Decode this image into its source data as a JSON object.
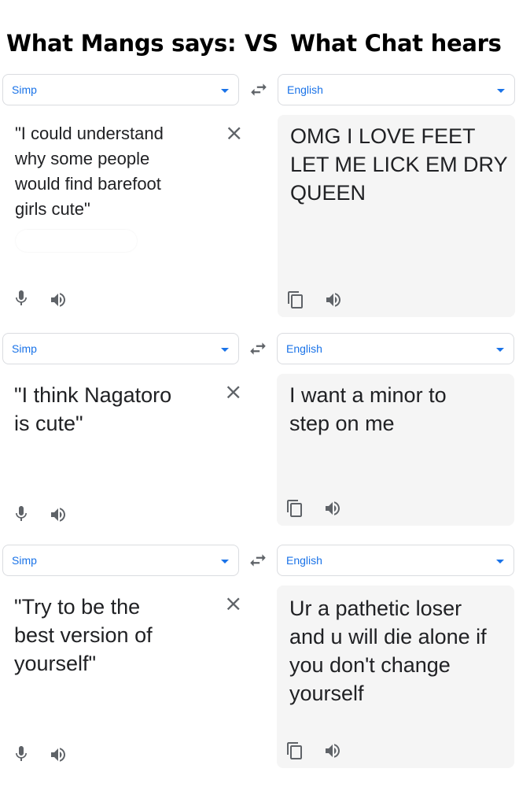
{
  "header": {
    "left": "What Mangs says:",
    "vs": "VS",
    "right": "What Chat hears"
  },
  "panels": [
    {
      "source_lang": "Simp",
      "target_lang": "English",
      "source_text": "\"I could understand\nwhy some people\nwould find barefoot\ngirls cute\"",
      "target_text": "OMG I LOVE FEET\nLET ME LICK EM DRY\nQUEEN"
    },
    {
      "source_lang": "Simp",
      "target_lang": "English",
      "source_text": "\"I think Nagatoro\nis cute\"",
      "target_text": "I want a minor to\nstep on me"
    },
    {
      "source_lang": "Simp",
      "target_lang": "English",
      "source_text": "\"Try to be the\nbest version of\nyourself\"",
      "target_text": "Ur a pathetic loser\nand u will die alone if\nyou don't change\nyourself"
    }
  ],
  "icons": {
    "close": "×",
    "colors": {
      "accent": "#1a73e8",
      "icon": "#5f6368",
      "target_bg": "#f5f5f5",
      "border": "#dadce0"
    }
  }
}
